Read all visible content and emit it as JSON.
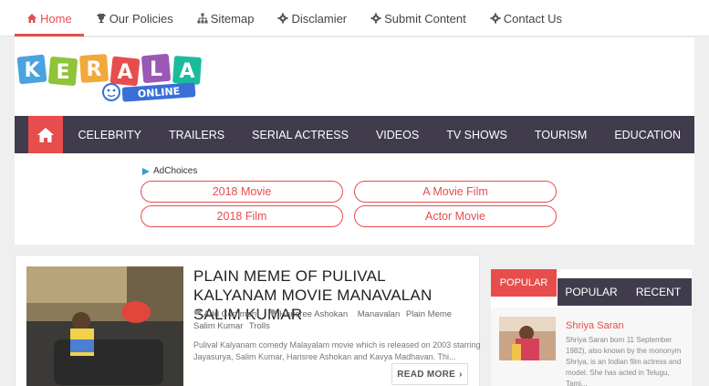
{
  "topnav": [
    {
      "label": "Home",
      "icon": "home-icon",
      "active": true
    },
    {
      "label": "Our Policies",
      "icon": "trophy-icon"
    },
    {
      "label": "Sitemap",
      "icon": "sitemap-icon"
    },
    {
      "label": "Disclamier",
      "icon": "gear-icon"
    },
    {
      "label": "Submit Content",
      "icon": "gear-icon"
    },
    {
      "label": "Contact Us",
      "icon": "gear-icon"
    }
  ],
  "logo": {
    "letters": [
      "K",
      "E",
      "R",
      "A",
      "L",
      "A"
    ],
    "sub": "ONLINE"
  },
  "mainnav": {
    "home_icon": "home-icon",
    "items": [
      "CELEBRITY",
      "TRAILERS",
      "SERIAL ACTRESS",
      "VIDEOS",
      "TV SHOWS",
      "TOURISM",
      "EDUCATION"
    ]
  },
  "ads": {
    "adchoices": "AdChoices",
    "buttons": [
      "2018 Movie",
      "A Movie Film",
      "2018 Film",
      "Actor Movie"
    ]
  },
  "post": {
    "title": "PLAIN MEME OF PULIVAL KALYANAM MOVIE MANAVALAN SALIM KUMAR",
    "comment": "Add Comment",
    "tags": [
      "Harisree Ashokan",
      "Manavalan",
      "Plain Meme",
      "Salim Kumar",
      "Trolls"
    ],
    "excerpt": "Pulival Kalyanam comedy Malayalam movie which is released on 2003 starring Jayasurya, Salim Kumar, Harisree Ashokan and Kavya Madhavan. Thi...",
    "read_more": "READ MORE"
  },
  "sidebar": {
    "tabs": [
      "POPULAR",
      "POPULAR",
      "RECENT"
    ],
    "item": {
      "title": "Shriya Saran",
      "desc": "Shriya Saran born 11 September 1982), also known by the mononym Shriya, is an Indian film actress and model. She has acted in Telugu, Tami..."
    }
  },
  "colors": {
    "accent": "#e84d4d",
    "nav_dark": "#403c4c"
  }
}
